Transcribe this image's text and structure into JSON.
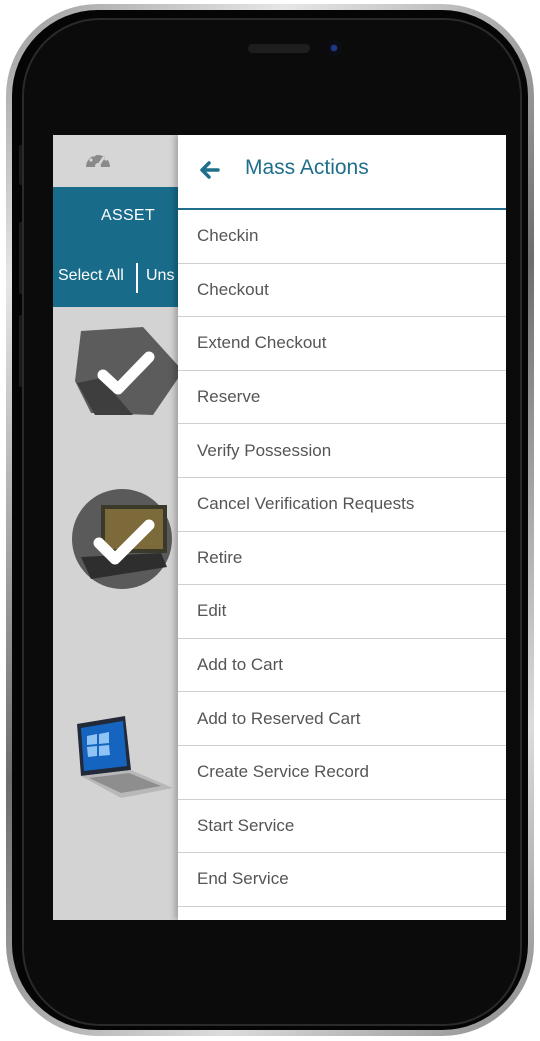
{
  "background_app": {
    "header_label": "ASSET",
    "select_all_label": "Select All",
    "unselect_label": "Uns",
    "dashboard_icon": "speedometer-icon",
    "brand_color": "#186c8a"
  },
  "drawer": {
    "back_icon": "arrow-left-icon",
    "title": "Mass Actions",
    "accent_color": "#1f6f8c",
    "items": [
      {
        "label": "Checkin"
      },
      {
        "label": "Checkout"
      },
      {
        "label": "Extend Checkout"
      },
      {
        "label": "Reserve"
      },
      {
        "label": "Verify Possession"
      },
      {
        "label": "Cancel Verification Requests"
      },
      {
        "label": "Retire"
      },
      {
        "label": "Edit"
      },
      {
        "label": "Add to Cart"
      },
      {
        "label": "Add to Reserved Cart"
      },
      {
        "label": "Create Service Record"
      },
      {
        "label": "Start Service"
      },
      {
        "label": "End Service"
      }
    ]
  }
}
